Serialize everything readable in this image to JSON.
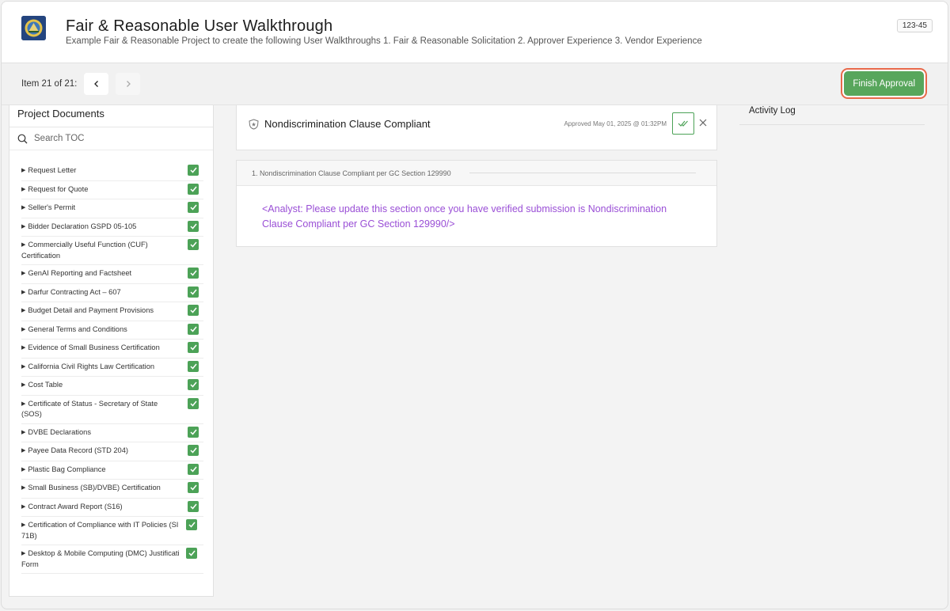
{
  "header": {
    "title": "Fair & Reasonable User Walkthrough",
    "subtitle": "Example Fair & Reasonable Project to create the following User Walkthroughs 1. Fair & Reasonable Solicitation 2. Approver Experience 3. Vendor Experience",
    "project_number": "123-45"
  },
  "toolbar": {
    "item_count": "Item 21 of 21:",
    "finish_label": "Finish Approval"
  },
  "sidebar": {
    "title": "Project Documents",
    "search_placeholder": "Search TOC",
    "items": [
      {
        "label": "Request Letter",
        "status": "approved"
      },
      {
        "label": "Request for Quote",
        "status": "approved"
      },
      {
        "label": "Seller's Permit",
        "status": "approved"
      },
      {
        "label": "Bidder Declaration GSPD 05-105",
        "status": "approved"
      },
      {
        "label": "Commercially Useful Function (CUF) Certification",
        "status": "approved"
      },
      {
        "label": "GenAI Reporting and Factsheet",
        "status": "approved"
      },
      {
        "label": "Darfur Contracting Act – 607",
        "status": "approved"
      },
      {
        "label": "Budget Detail and Payment Provisions",
        "status": "approved"
      },
      {
        "label": "General Terms and Conditions",
        "status": "approved"
      },
      {
        "label": "Evidence of Small Business Certification",
        "status": "approved"
      },
      {
        "label": "California Civil Rights Law Certification",
        "status": "approved"
      },
      {
        "label": "Cost Table",
        "status": "approved"
      },
      {
        "label": "Certificate of Status - Secretary of State (SOS)",
        "status": "approved"
      },
      {
        "label": "DVBE Declarations",
        "status": "approved"
      },
      {
        "label": "Payee Data Record (STD 204)",
        "status": "approved"
      },
      {
        "label": "Plastic Bag Compliance",
        "status": "approved"
      },
      {
        "label": "Small Business (SB)/DVBE) Certification",
        "status": "approved"
      },
      {
        "label": "Contract Award Report (S16)",
        "status": "approved"
      },
      {
        "label": "Certification of Compliance with IT Policies (SI",
        "label2": "71B)",
        "status": "approved"
      },
      {
        "label": "Desktop & Mobile Computing (DMC) Justificati",
        "label2": "Form",
        "status": "approved"
      }
    ]
  },
  "section": {
    "title": "Nondiscrimination Clause Compliant",
    "approved_text": "Approved May 01, 2025 @ 01:32PM"
  },
  "content": {
    "heading": "1. Nondiscrimination Clause Compliant per GC Section 129990",
    "body": "<Analyst: Please update this section once you have verified submission is Nondiscrimination Clause Compliant per GC Section 129990/>"
  },
  "activity": {
    "title": "Activity Log"
  },
  "colors": {
    "accent_green": "#58a65c",
    "focus_ring": "#e8694a",
    "placeholder_purple": "#9a4fd6"
  }
}
